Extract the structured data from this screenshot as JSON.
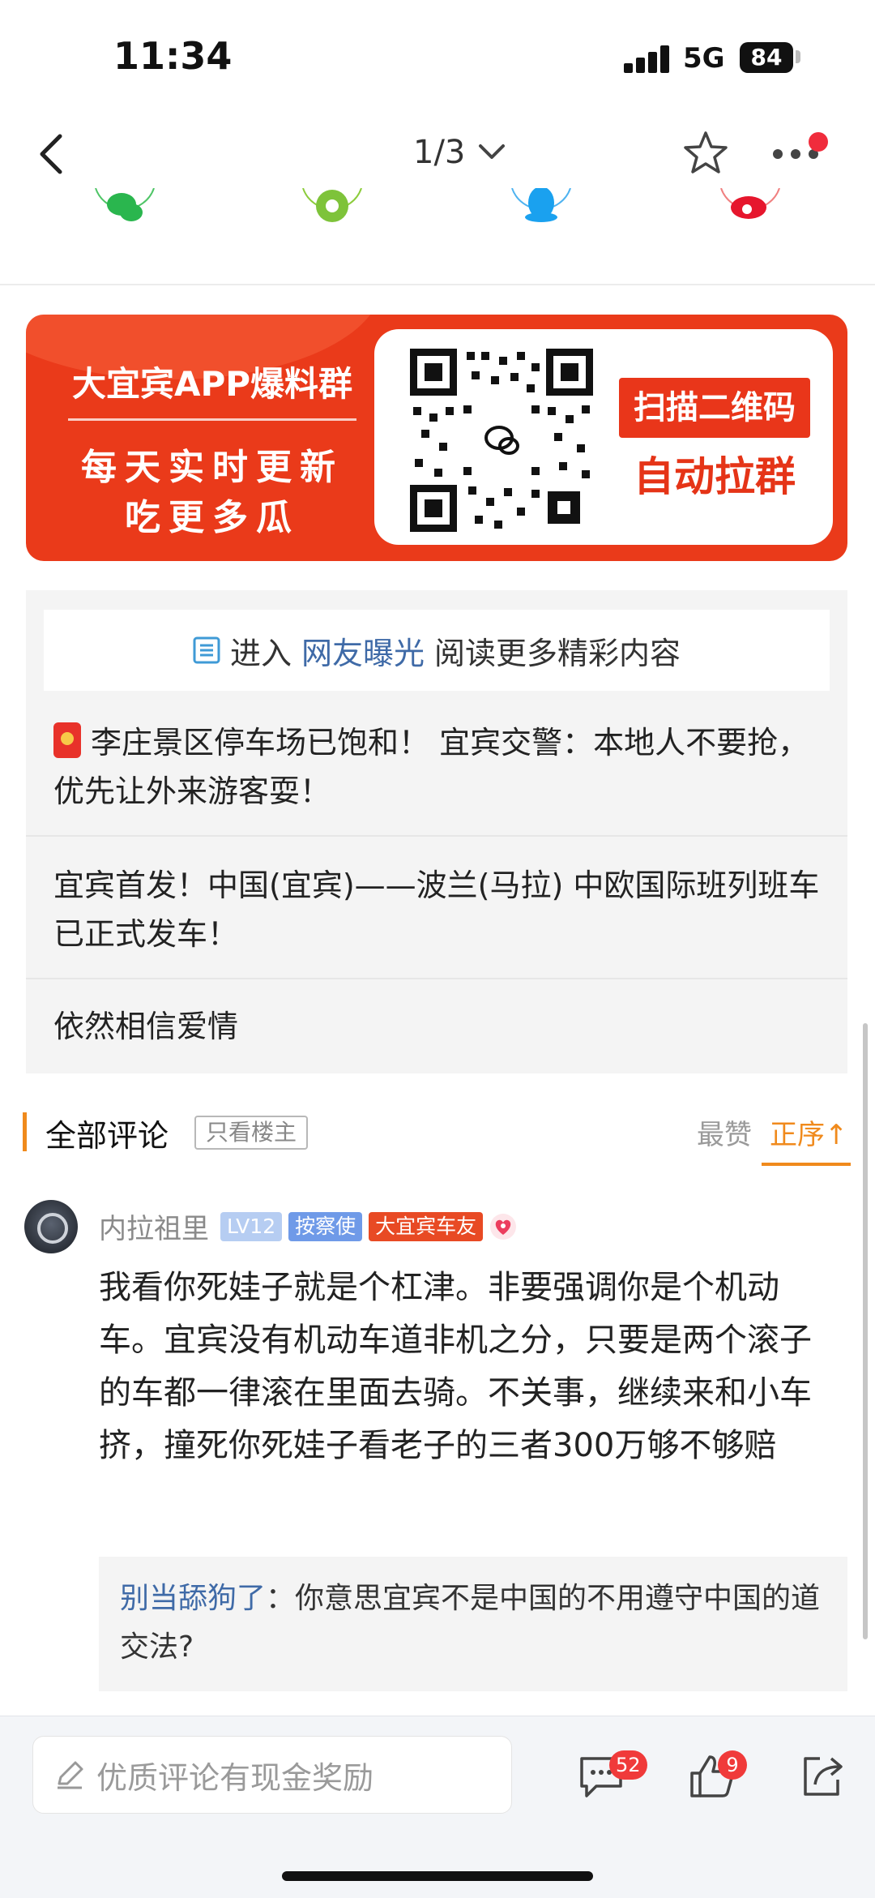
{
  "status_bar": {
    "time": "11:34",
    "network": "5G",
    "battery": "84"
  },
  "nav": {
    "pager": "1/3"
  },
  "share_icons": [
    "wechat-icon",
    "moments-icon",
    "qq-icon",
    "weibo-icon"
  ],
  "banner": {
    "title": "大宜宾APP爆料群",
    "line1": "每天实时更新",
    "line2": "吃更多瓜",
    "scan_label": "扫描二维码",
    "join_label": "自动拉群"
  },
  "related": {
    "enter_prefix": "进入",
    "enter_link": "网友曝光",
    "enter_suffix": "阅读更多精彩内容",
    "items": [
      "李庄景区停车场已饱和！ 宜宾交警：本地人不要抢，优先让外来游客耍！",
      "宜宾首发！中国(宜宾)——波兰(马拉) 中欧国际班列班车已正式发车！",
      "依然相信爱情"
    ]
  },
  "comments_header": {
    "title": "全部评论",
    "filter_label": "只看楼主",
    "sort_best": "最赞",
    "sort_order": "正序↑"
  },
  "comment": {
    "username": "内拉祖里",
    "badges": [
      "LV12",
      "按察使",
      "大宜宾车友"
    ],
    "text": "我看你死娃子就是个杠津。非要强调你是个机动车。宜宾没有机动车道非机之分，只要是两个滚子的车都一律滚在里面去骑。不关事，继续来和小车挤，撞死你死娃子看老子的三者300万够不够赔",
    "reply": {
      "user": "别当舔狗了",
      "separator": "：",
      "text": "你意思宜宾不是中国的不用遵守中国的道交法?"
    }
  },
  "bottom_bar": {
    "input_placeholder": "优质评论有现金奖励",
    "comment_count": "52",
    "like_count": "9"
  },
  "colors": {
    "accent": "#f08a1c",
    "link": "#3f6aa7",
    "banner": "#ea3a1a"
  }
}
